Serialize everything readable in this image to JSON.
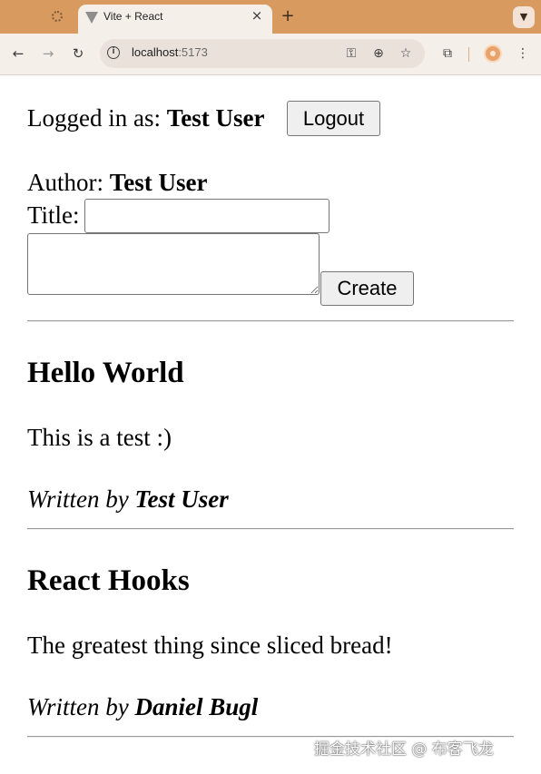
{
  "browser": {
    "tabs": [
      {
        "label": ""
      },
      {
        "label": "Vite + React"
      }
    ],
    "address": {
      "host": "localhost",
      "port": ":5173"
    }
  },
  "user_bar": {
    "prefix": "Logged in as: ",
    "username": "Test User",
    "logout_label": "Logout"
  },
  "create_form": {
    "author_prefix": "Author: ",
    "author_name": "Test User",
    "title_label": "Title:",
    "title_value": "",
    "content_value": "",
    "create_label": "Create"
  },
  "posts": [
    {
      "title": "Hello World",
      "content": "This is a test :)",
      "by_prefix": "Written by ",
      "author": "Test User"
    },
    {
      "title": "React Hooks",
      "content": "The greatest thing since sliced bread!",
      "by_prefix": "Written by ",
      "author": "Daniel Bugl"
    }
  ],
  "watermark": "掘金技术社区 @ 布客飞龙",
  "colors": {
    "tabstrip": "#d99a5f",
    "toolbar": "#f5efe9"
  }
}
